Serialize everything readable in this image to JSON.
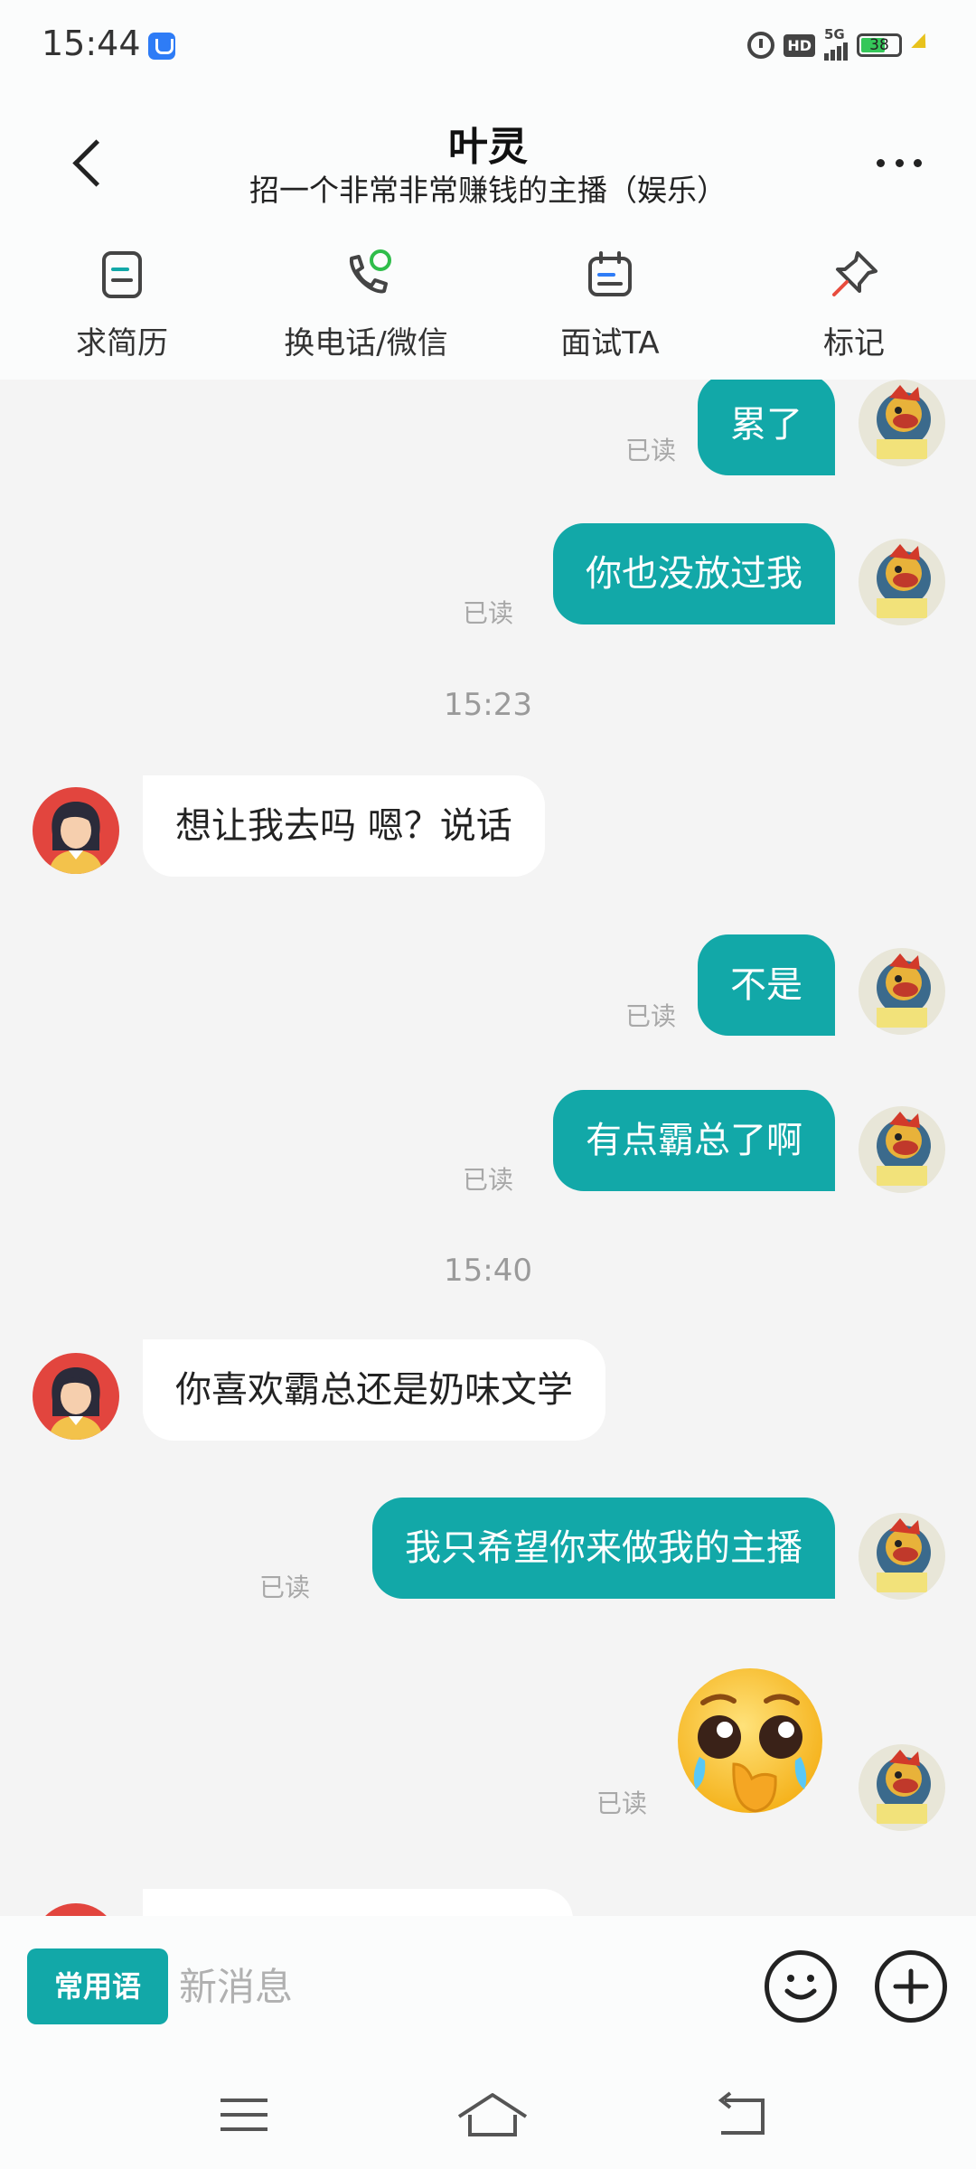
{
  "status_bar": {
    "time": "15:44",
    "hd": "HD",
    "network": "5G",
    "battery": "38"
  },
  "header": {
    "title": "叶灵",
    "subtitle": "招一个非常非常赚钱的主播（娱乐）",
    "back_icon": "chevron-left-icon",
    "more_icon": "more-dots-icon"
  },
  "actions": [
    {
      "label": "求简历",
      "icon": "resume-icon"
    },
    {
      "label": "换电话/微信",
      "icon": "phone-wechat-icon"
    },
    {
      "label": "面试TA",
      "icon": "calendar-icon"
    },
    {
      "label": "标记",
      "icon": "pin-icon"
    }
  ],
  "messages": [
    {
      "side": "me",
      "text": "累了",
      "status": "已读"
    },
    {
      "side": "me",
      "text": "你也没放过我",
      "status": "已读"
    },
    {
      "time": "15:23"
    },
    {
      "side": "her",
      "text": "想让我去吗 嗯？说话"
    },
    {
      "side": "me",
      "text": "不是",
      "status": "已读"
    },
    {
      "side": "me",
      "text": "有点霸总了啊",
      "status": "已读"
    },
    {
      "time": "15:40"
    },
    {
      "side": "her",
      "text": "你喜欢霸总还是奶味文学"
    },
    {
      "side": "me",
      "text": "我只希望你来做我的主播",
      "status": "已读"
    },
    {
      "side": "me",
      "sticker": "crying-face-emoji",
      "status": "已读"
    }
  ],
  "input_bar": {
    "common_phrases": "常用语",
    "placeholder": "新消息",
    "emoji_icon": "smiley-icon",
    "plus_icon": "plus-icon"
  },
  "colors": {
    "accent": "#12a8a8",
    "background": "#f4f4f4",
    "bubble_other": "#ffffff"
  }
}
